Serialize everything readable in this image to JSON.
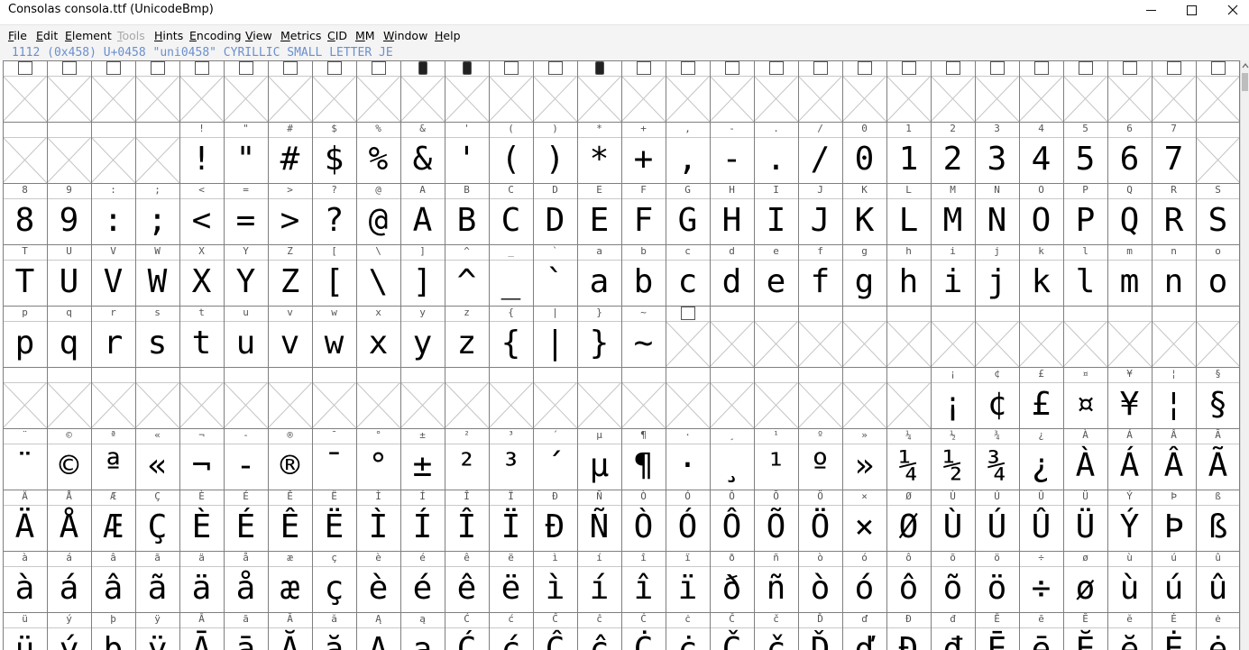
{
  "window": {
    "title": "Consolas  consola.ttf (UnicodeBmp)",
    "minimize_icon": "minimize-icon",
    "maximize_icon": "maximize-icon",
    "close_icon": "close-icon"
  },
  "menu": [
    {
      "label": "File",
      "u": "F",
      "rest": "ile",
      "enabled": true
    },
    {
      "label": "Edit",
      "u": "E",
      "rest": "dit",
      "enabled": true
    },
    {
      "label": "Element",
      "u": "E",
      "rest": "lement",
      "enabled": true
    },
    {
      "label": "Tools",
      "u": "T",
      "rest": "ools",
      "enabled": false
    },
    {
      "label": "Hints",
      "u": "H",
      "rest": "ints",
      "enabled": true
    },
    {
      "label": "Encoding",
      "u": "E",
      "rest": "ncoding",
      "enabled": true
    },
    {
      "label": "View",
      "u": "V",
      "rest": "iew",
      "enabled": true
    },
    {
      "label": "Metrics",
      "u": "M",
      "rest": "etrics",
      "enabled": true
    },
    {
      "label": "CID",
      "u": "C",
      "rest": "ID",
      "enabled": true
    },
    {
      "label": "MM",
      "u": "M",
      "rest": "M",
      "enabled": true
    },
    {
      "label": "Window",
      "u": "W",
      "rest": "indow",
      "enabled": true
    },
    {
      "label": "Help",
      "u": "H",
      "rest": "elp",
      "enabled": true
    }
  ],
  "info_line": "1112 (0x458) U+0458 \"uni0458\" CYRILLIC SMALL LETTER JE",
  "grid": {
    "columns": 28,
    "rows": [
      {
        "start": 0,
        "labels": [
          "?",
          "",
          "",
          "",
          "",
          "",
          "",
          "",
          "",
          "",
          "",
          "",
          "",
          "",
          "",
          "",
          "",
          "",
          "",
          "",
          "",
          "",
          "",
          "",
          "",
          "",
          "",
          ""
        ],
        "glyphs": [
          "",
          "",
          "",
          "",
          "",
          "",
          "",
          "",
          "",
          "",
          "",
          "",
          "",
          "",
          "",
          "",
          "",
          "",
          "",
          "",
          "",
          "",
          "",
          "",
          "",
          "",
          "",
          ""
        ],
        "markers": [
          1,
          1,
          1,
          1,
          1,
          1,
          1,
          1,
          1,
          2,
          2,
          1,
          1,
          2,
          1,
          1,
          1,
          1,
          1,
          1,
          1,
          1,
          1,
          1,
          1,
          1,
          1,
          1
        ]
      },
      {
        "start": 28,
        "labels": [
          "",
          "",
          "",
          "",
          "!",
          "\"",
          "#",
          "$",
          "%",
          "&",
          "'",
          "(",
          ")",
          "*",
          "+",
          ",",
          "-",
          ".",
          "/",
          "0",
          "1",
          "2",
          "3",
          "4",
          "5",
          "6",
          "7"
        ],
        "glyphs": [
          "",
          "",
          "",
          "",
          "!",
          "\"",
          "#",
          "$",
          "%",
          "&",
          "'",
          "(",
          ")",
          "*",
          "+",
          ",",
          "-",
          ".",
          "/",
          "0",
          "1",
          "2",
          "3",
          "4",
          "5",
          "6",
          "7"
        ]
      },
      {
        "start": 56,
        "labels": [
          "8",
          "9",
          ":",
          ";",
          "<",
          "=",
          ">",
          "?",
          "@",
          "A",
          "B",
          "C",
          "D",
          "E",
          "F",
          "G",
          "H",
          "I",
          "J",
          "K",
          "L",
          "M",
          "N",
          "O",
          "P",
          "Q",
          "R",
          "S"
        ],
        "glyphs": [
          "8",
          "9",
          ":",
          ";",
          "<",
          "=",
          ">",
          "?",
          "@",
          "A",
          "B",
          "C",
          "D",
          "E",
          "F",
          "G",
          "H",
          "I",
          "J",
          "K",
          "L",
          "M",
          "N",
          "O",
          "P",
          "Q",
          "R",
          "S"
        ]
      },
      {
        "start": 84,
        "labels": [
          "T",
          "U",
          "V",
          "W",
          "X",
          "Y",
          "Z",
          "[",
          "\\",
          "]",
          "^",
          "_",
          "`",
          "a",
          "b",
          "c",
          "d",
          "e",
          "f",
          "g",
          "h",
          "i",
          "j",
          "k",
          "l",
          "m",
          "n",
          "o"
        ],
        "glyphs": [
          "T",
          "U",
          "V",
          "W",
          "X",
          "Y",
          "Z",
          "[",
          "\\",
          "]",
          "^",
          "_",
          "`",
          "a",
          "b",
          "c",
          "d",
          "e",
          "f",
          "g",
          "h",
          "i",
          "j",
          "k",
          "l",
          "m",
          "n",
          "o"
        ]
      },
      {
        "start": 112,
        "labels": [
          "p",
          "q",
          "r",
          "s",
          "t",
          "u",
          "v",
          "w",
          "x",
          "y",
          "z",
          "{",
          "|",
          "}",
          "~",
          "",
          "",
          "",
          "",
          "",
          "",
          "",
          "",
          "",
          "",
          "",
          "",
          ""
        ],
        "glyphs": [
          "p",
          "q",
          "r",
          "s",
          "t",
          "u",
          "v",
          "w",
          "x",
          "y",
          "z",
          "{",
          "|",
          "}",
          "~",
          "",
          "",
          "",
          "",
          "",
          "",
          "",
          "",
          "",
          "",
          "",
          "",
          ""
        ],
        "markers": [
          0,
          0,
          0,
          0,
          0,
          0,
          0,
          0,
          0,
          0,
          0,
          0,
          0,
          0,
          0,
          1,
          0,
          0,
          0,
          0,
          0,
          0,
          0,
          0,
          0,
          0,
          0,
          0
        ]
      },
      {
        "start": 140,
        "labels": [
          "",
          "",
          "",
          "",
          "",
          "",
          "",
          "",
          "",
          "",
          "",
          "",
          "",
          "",
          "",
          "",
          "",
          "",
          "",
          "",
          "",
          "¡",
          "¢",
          "£",
          "¤",
          "¥",
          "¦",
          "§"
        ],
        "glyphs": [
          "",
          "",
          "",
          "",
          "",
          "",
          "",
          "",
          "",
          "",
          "",
          "",
          "",
          "",
          "",
          "",
          "",
          "",
          "",
          "",
          "",
          "¡",
          "¢",
          "£",
          "¤",
          "¥",
          "¦",
          "§"
        ]
      },
      {
        "start": 168,
        "labels": [
          "¨",
          "©",
          "ª",
          "«",
          "¬",
          "-",
          "®",
          "¯",
          "°",
          "±",
          "²",
          "³",
          "´",
          "µ",
          "¶",
          "·",
          "¸",
          "¹",
          "º",
          "»",
          "¼",
          "½",
          "¾",
          "¿",
          "À",
          "Á",
          "Â",
          "Ã"
        ],
        "glyphs": [
          "¨",
          "©",
          "ª",
          "«",
          "¬",
          "-",
          "®",
          "¯",
          "°",
          "±",
          "²",
          "³",
          "´",
          "µ",
          "¶",
          "·",
          "¸",
          "¹",
          "º",
          "»",
          "¼",
          "½",
          "¾",
          "¿",
          "À",
          "Á",
          "Â",
          "Ã"
        ]
      },
      {
        "start": 196,
        "labels": [
          "Ä",
          "Å",
          "Æ",
          "Ç",
          "È",
          "É",
          "Ê",
          "Ë",
          "Ì",
          "Í",
          "Î",
          "Ï",
          "Ð",
          "Ñ",
          "Ò",
          "Ó",
          "Ô",
          "Õ",
          "Ö",
          "×",
          "Ø",
          "Ù",
          "Ú",
          "Û",
          "Ü",
          "Ý",
          "Þ",
          "ß"
        ],
        "glyphs": [
          "Ä",
          "Å",
          "Æ",
          "Ç",
          "È",
          "É",
          "Ê",
          "Ë",
          "Ì",
          "Í",
          "Î",
          "Ï",
          "Ð",
          "Ñ",
          "Ò",
          "Ó",
          "Ô",
          "Õ",
          "Ö",
          "×",
          "Ø",
          "Ù",
          "Ú",
          "Û",
          "Ü",
          "Ý",
          "Þ",
          "ß"
        ]
      },
      {
        "start": 224,
        "labels": [
          "à",
          "á",
          "â",
          "ã",
          "ä",
          "å",
          "æ",
          "ç",
          "è",
          "é",
          "ê",
          "ë",
          "ì",
          "í",
          "î",
          "ï",
          "ð",
          "ñ",
          "ò",
          "ó",
          "ô",
          "õ",
          "ö",
          "÷",
          "ø",
          "ù",
          "ú",
          "û"
        ],
        "glyphs": [
          "à",
          "á",
          "â",
          "ã",
          "ä",
          "å",
          "æ",
          "ç",
          "è",
          "é",
          "ê",
          "ë",
          "ì",
          "í",
          "î",
          "ï",
          "ð",
          "ñ",
          "ò",
          "ó",
          "ô",
          "õ",
          "ö",
          "÷",
          "ø",
          "ù",
          "ú",
          "û"
        ]
      },
      {
        "start": 252,
        "labels": [
          "ü",
          "ý",
          "þ",
          "ÿ",
          "Ā",
          "ā",
          "Ă",
          "ă",
          "Ą",
          "ą",
          "Ć",
          "ć",
          "Ĉ",
          "ĉ",
          "Ċ",
          "ċ",
          "Č",
          "č",
          "Ď",
          "ď",
          "Đ",
          "đ",
          "Ē",
          "ē",
          "Ĕ",
          "ĕ",
          "Ė",
          "ė"
        ],
        "glyphs": [
          "ü",
          "ý",
          "þ",
          "ÿ",
          "Ā",
          "ā",
          "Ă",
          "ă",
          "Ą",
          "ą",
          "Ć",
          "ć",
          "Ĉ",
          "ĉ",
          "Ċ",
          "ċ",
          "Č",
          "č",
          "Ď",
          "ď",
          "Đ",
          "đ",
          "Ē",
          "ē",
          "Ĕ",
          "ĕ",
          "Ė",
          "ė"
        ]
      }
    ]
  },
  "scrollbar": {
    "up_icon": "chevron-up-icon"
  }
}
